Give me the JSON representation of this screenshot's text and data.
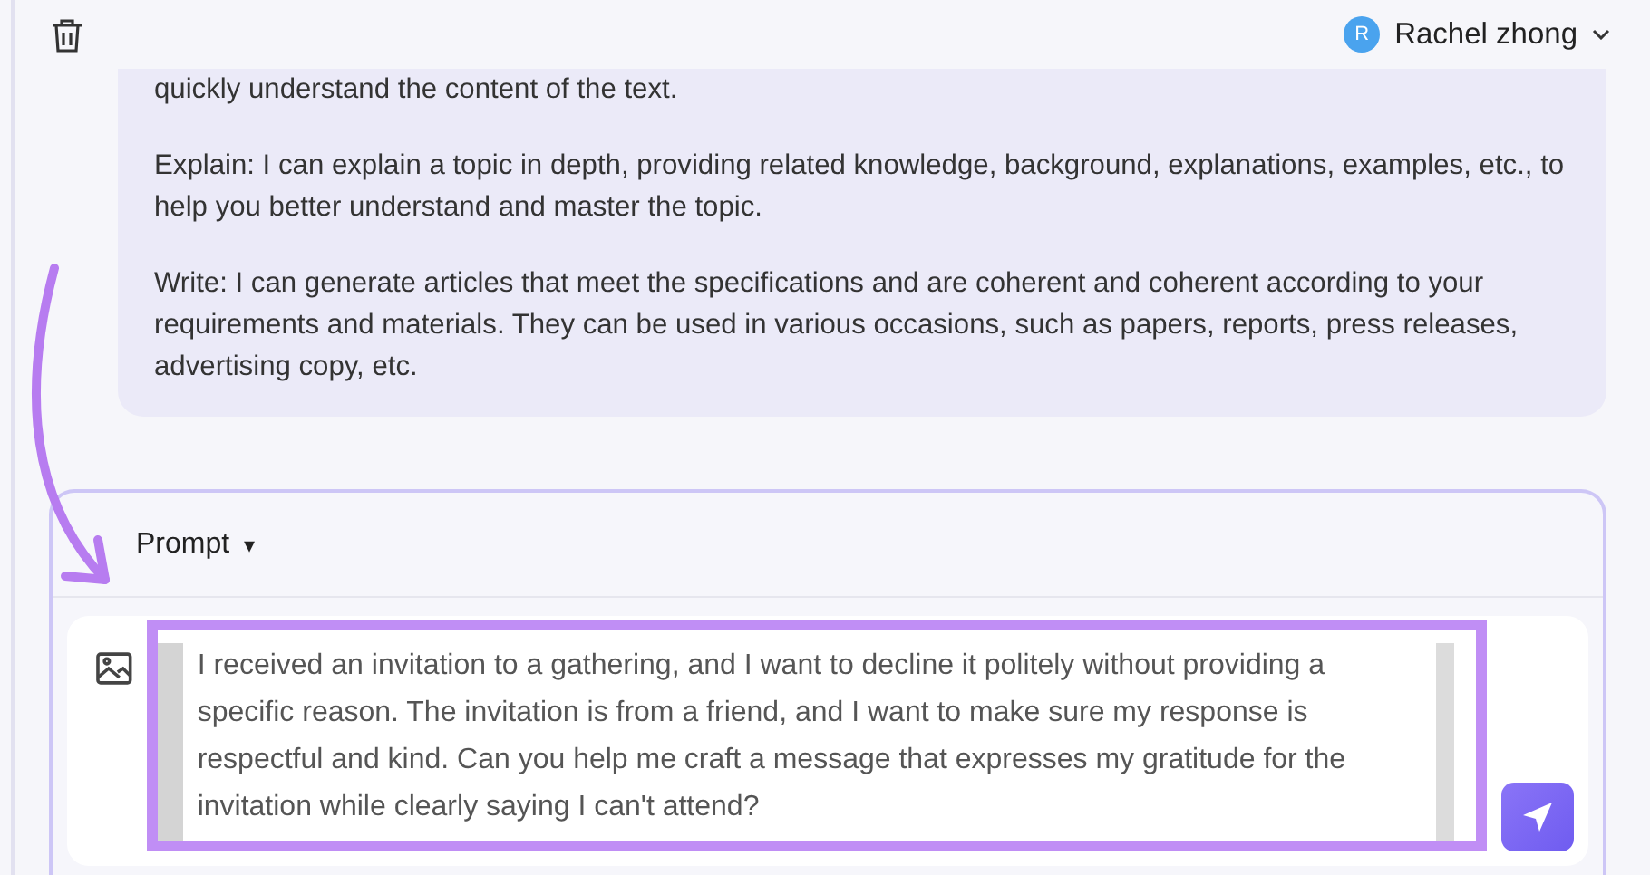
{
  "header": {
    "user_name": "Rachel zhong",
    "avatar_letter": "R"
  },
  "reply": {
    "paragraphs": [
      "quickly understand the content of the text.",
      "Explain: I can explain a topic in depth, providing related knowledge, background, explanations, examples, etc., to help you better understand and master the topic.",
      "Write: I can generate articles that meet the specifications and are coherent and coherent according to your requirements and materials. They can be used in various occasions, such as papers, reports, press releases, advertising copy, etc."
    ]
  },
  "composer": {
    "mode_label": "Prompt",
    "mode_caret": "▾",
    "prompt_text": "I received an invitation to a gathering, and I want to decline it politely without providing a specific reason. The invitation is from a friend, and I want to make sure my response is respectful and kind. Can you help me craft a message that expresses my gratitude for the invitation while clearly saying I can't attend?"
  }
}
